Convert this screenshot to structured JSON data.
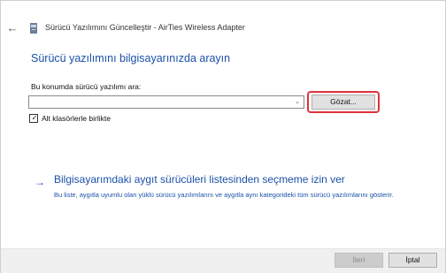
{
  "window": {
    "title": "Sürücü Yazılımını Güncelleştir - AirTies Wireless Adapter",
    "back_icon": "back-arrow-icon",
    "app_icon": "device-icon"
  },
  "main": {
    "heading": "Sürücü yazılımını bilgisayarınızda arayın",
    "location_label": "Bu konumda sürücü yazılımı ara:",
    "location_value": "",
    "browse_label": "Gözat...",
    "include_subfolders_label": "Alt klasörlerle birlikte",
    "include_subfolders_checked": true,
    "pick_link": {
      "title": "Bilgisayarımdaki aygıt sürücüleri listesinden seçmeme izin ver",
      "description": "Bu liste, aygıtla uyumlu olan yüklü sürücü yazılımlarını ve aygıtla aynı kategorideki tüm sürücü yazılımlarını gösterir."
    }
  },
  "footer": {
    "next_label": "İleri",
    "cancel_label": "İptal"
  },
  "colors": {
    "accent": "#1a50a8",
    "highlight": "#e0323c"
  }
}
